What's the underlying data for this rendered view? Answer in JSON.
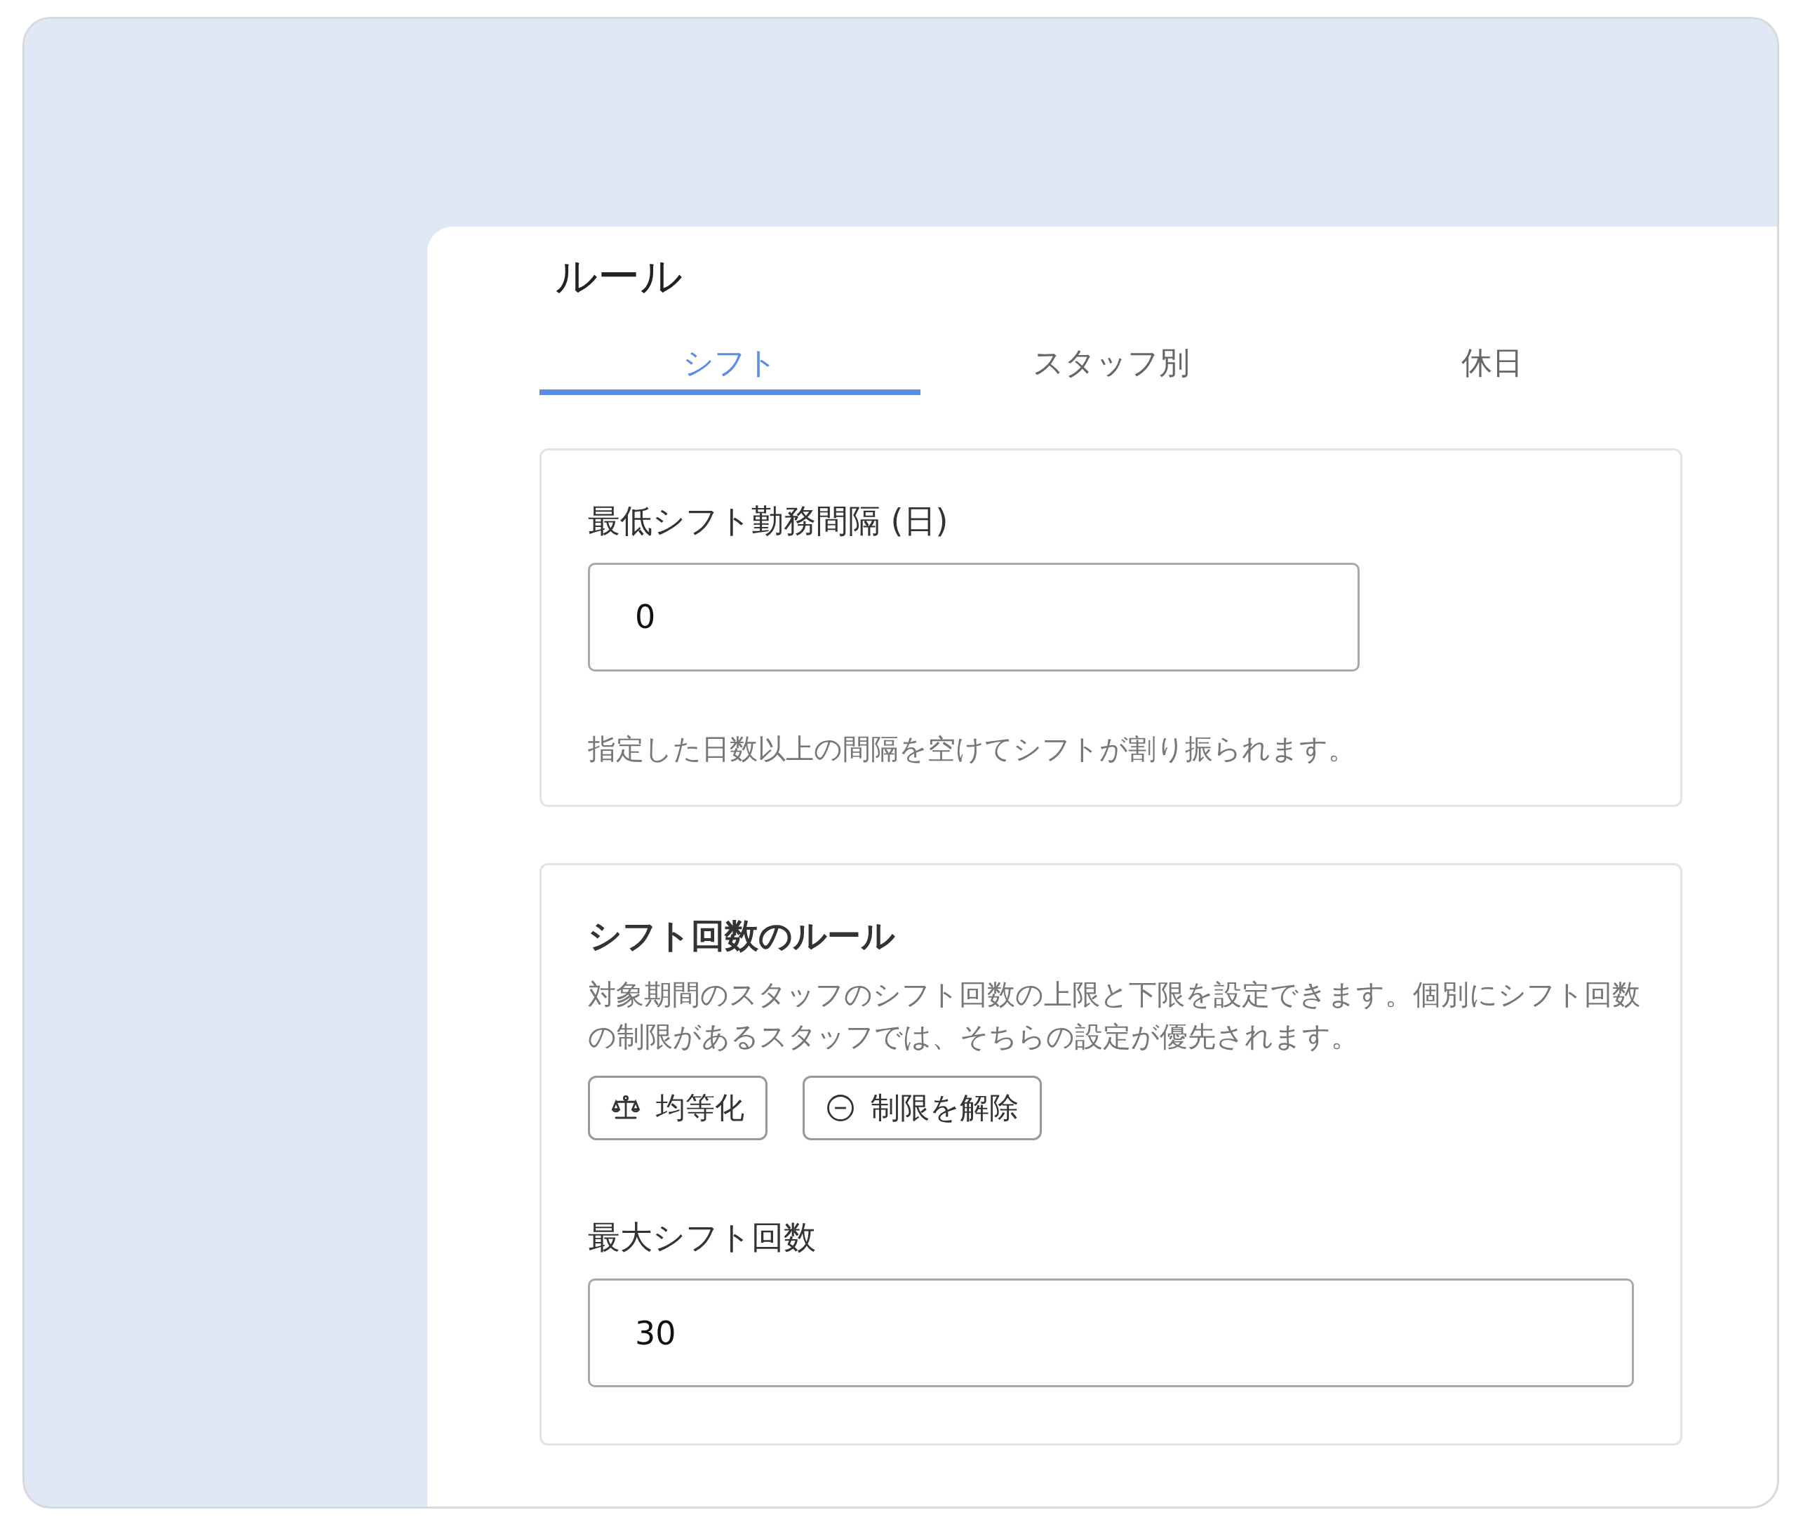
{
  "page": {
    "title": "ルール"
  },
  "tabs": [
    {
      "label": "シフト",
      "selected": true
    },
    {
      "label": "スタッフ別",
      "selected": false
    },
    {
      "label": "休日",
      "selected": false
    }
  ],
  "interval_card": {
    "label": "最低シフト勤務間隔 (日)",
    "value": "0",
    "help": "指定した日数以上の間隔を空けてシフトが割り振られます。"
  },
  "count_card": {
    "heading": "シフト回数のルール",
    "description": "対象期間のスタッフのシフト回数の上限と下限を設定できます。個別にシフト回数の制限があるスタッフでは、そちらの設定が優先されます。",
    "buttons": [
      {
        "kind": "balance",
        "label": "均等化"
      },
      {
        "kind": "remove",
        "label": "制限を解除"
      }
    ],
    "max_label": "最大シフト回数",
    "max_value": "30"
  }
}
